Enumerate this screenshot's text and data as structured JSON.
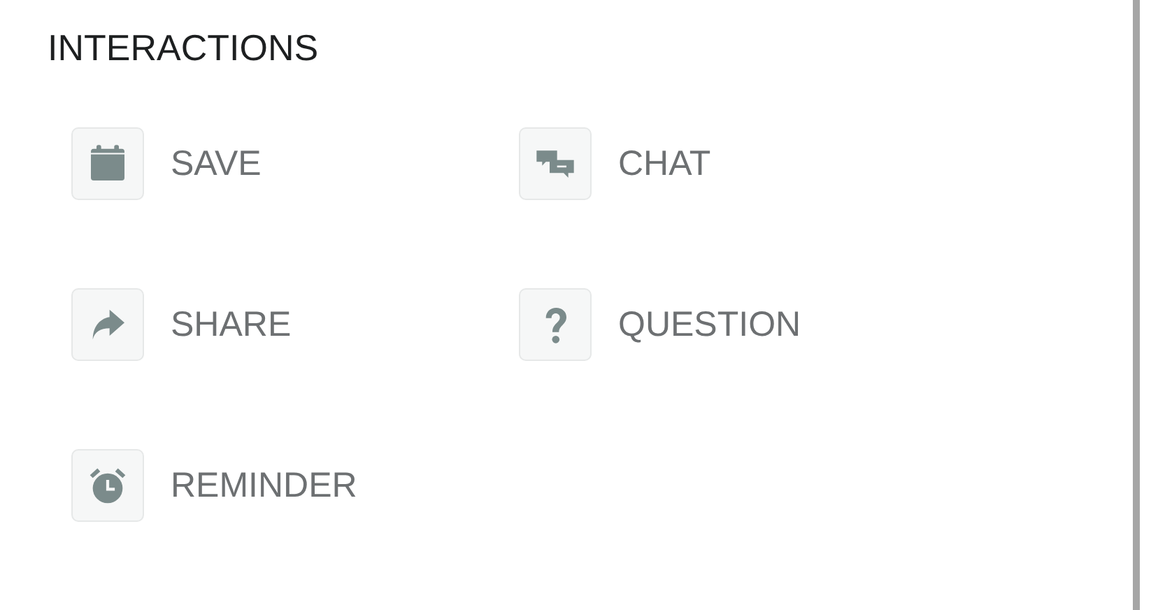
{
  "section": {
    "title": "INTERACTIONS"
  },
  "items": [
    {
      "kind": "save",
      "label": "SAVE"
    },
    {
      "kind": "chat",
      "label": "CHAT"
    },
    {
      "kind": "share",
      "label": "SHARE"
    },
    {
      "kind": "question",
      "label": "QUESTION"
    },
    {
      "kind": "reminder",
      "label": "REMINDER"
    }
  ]
}
